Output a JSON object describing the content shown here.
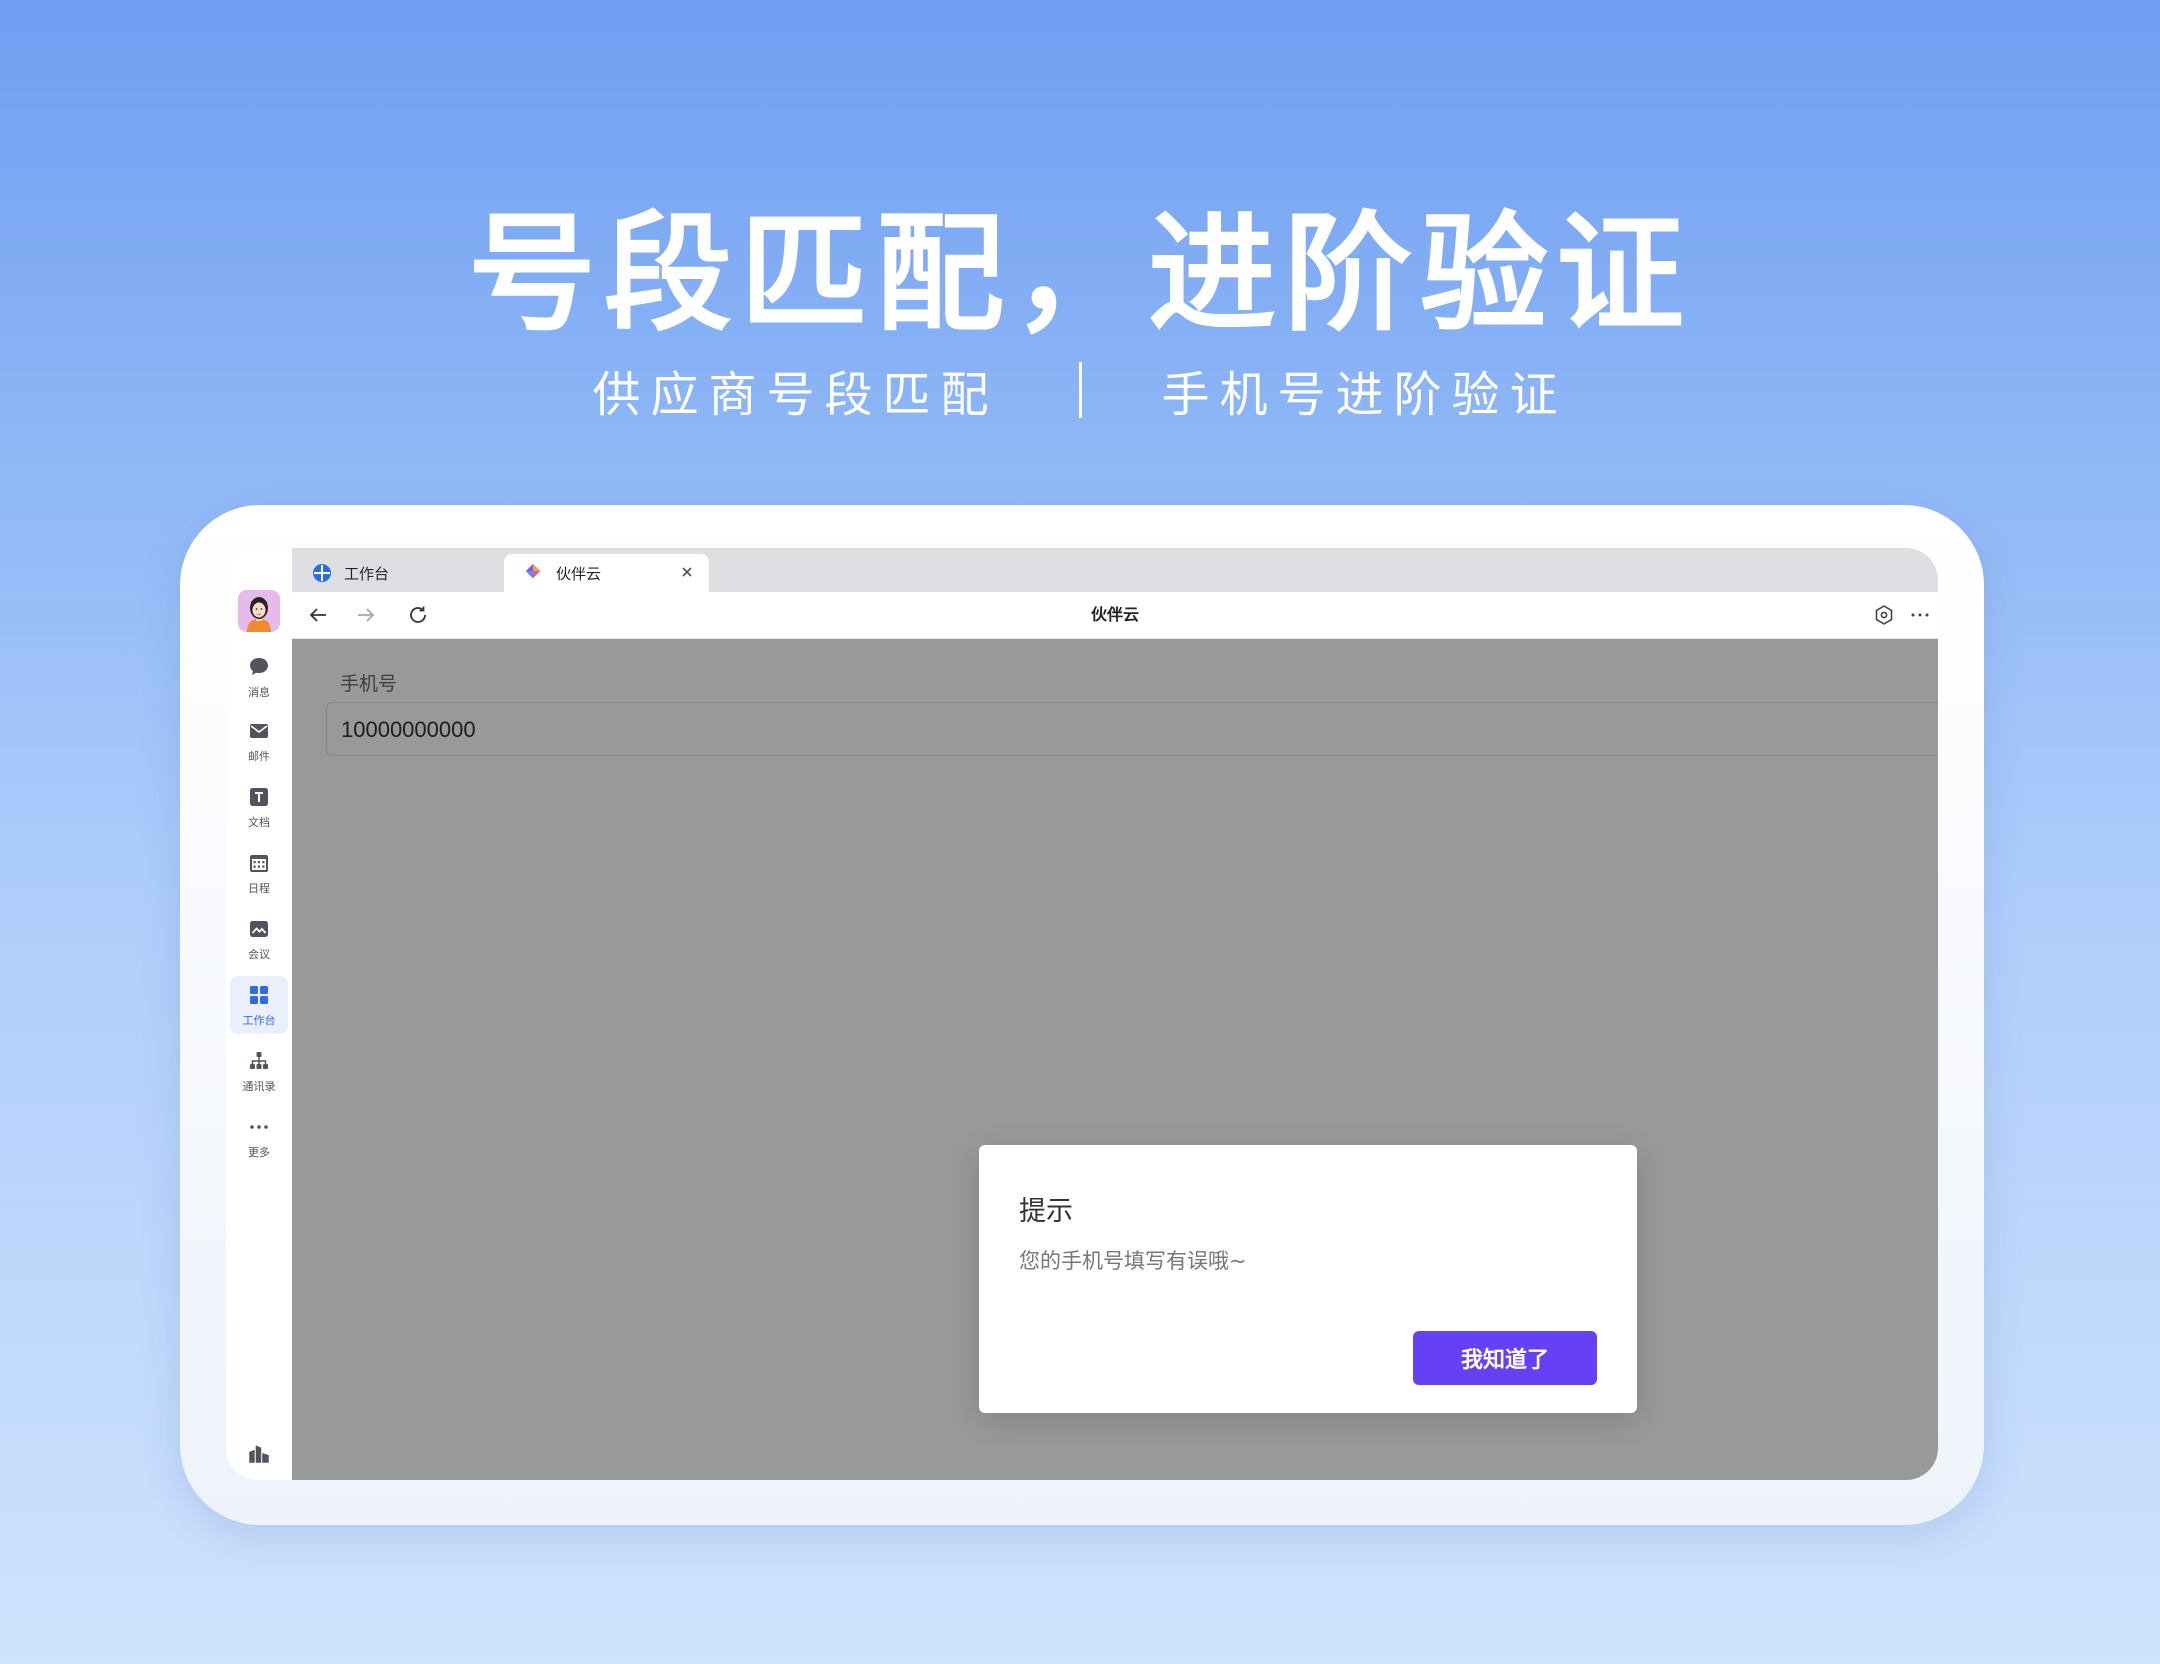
{
  "banner": {
    "headline": "号段匹配，进阶验证",
    "sub_left": "供应商号段匹配",
    "sub_right": "手机号进阶验证"
  },
  "rail": {
    "items": [
      {
        "label": "消息",
        "icon": "chat-bubble-icon"
      },
      {
        "label": "邮件",
        "icon": "mail-icon"
      },
      {
        "label": "文档",
        "icon": "docs-icon"
      },
      {
        "label": "日程",
        "icon": "calendar-icon"
      },
      {
        "label": "会议",
        "icon": "meeting-icon"
      },
      {
        "label": "工作台",
        "icon": "workbench-grid-icon",
        "active": true
      },
      {
        "label": "通讯录",
        "icon": "org-contacts-icon"
      },
      {
        "label": "更多",
        "icon": "more-dots-icon"
      }
    ]
  },
  "browser": {
    "tabs": [
      {
        "label": "工作台",
        "icon": "workbench-tab-icon",
        "active": false
      },
      {
        "label": "伙伴云",
        "icon": "huobanyun-logo-icon",
        "active": true
      }
    ],
    "page_title": "伙伴云"
  },
  "form": {
    "phone_label": "手机号",
    "phone_value": "10000000000"
  },
  "dialog": {
    "title": "提示",
    "message": "您的手机号填写有误哦~",
    "confirm_label": "我知道了"
  },
  "colors": {
    "accent_button": "#6540f5",
    "active_blue": "#2f6be8",
    "overlay": "rgba(0,0,0,0.4)"
  }
}
